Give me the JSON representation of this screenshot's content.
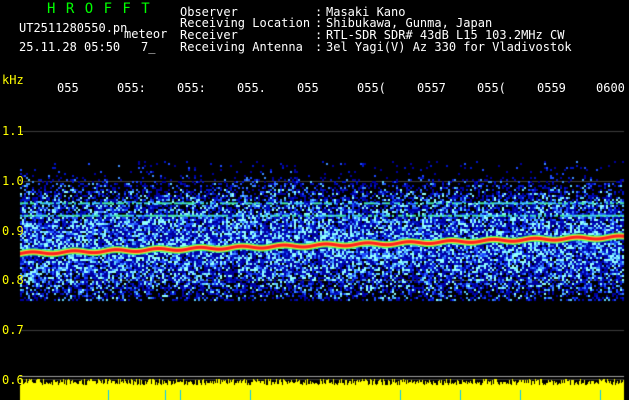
{
  "header": {
    "logo": "H R O F F T",
    "filename": "UT2511280550.pn",
    "suffix": "meteor",
    "datetime": "25.11.28 05:50",
    "count": "7_",
    "fields": [
      {
        "label": "Observer",
        "sep": ":",
        "value": "Masaki Kano"
      },
      {
        "label": "Receiving Location",
        "sep": ":",
        "value": "Shibukawa, Gunma, Japan"
      },
      {
        "label": "Receiver",
        "sep": ":",
        "value": "RTL-SDR SDR# 43dB L15 103.2MHz CW"
      },
      {
        "label": "Receiving Antenna",
        "sep": ":",
        "value": "3el Yagi(V) Az 330 for Vladivostok"
      }
    ]
  },
  "chart_data": {
    "type": "heatmap",
    "ylabel": "kHz",
    "yticks": [
      "1.1",
      "1.0",
      "0.9",
      "0.8",
      "0.7",
      "0.6"
    ],
    "ytick_values": [
      1.1,
      1.0,
      0.9,
      0.8,
      0.7,
      0.6
    ],
    "xticks": [
      "055",
      "055",
      "055",
      "055",
      "055",
      "055",
      "055",
      "055",
      "055",
      "0600"
    ],
    "xticks_shown_as": [
      "055",
      "055:",
      "055:",
      "055.",
      "055",
      "055(",
      "0557",
      "055(",
      "0559",
      "0600"
    ],
    "ylim": [
      0.58,
      1.15
    ],
    "noise_band_khz": [
      0.76,
      1.04
    ],
    "carrier": {
      "start_khz": 0.855,
      "end_khz": 0.888,
      "color": "#ff2020"
    },
    "faint_lines_khz": [
      0.955,
      0.93
    ],
    "colors": {
      "noise_dark": "#0000a0",
      "noise_mid": "#1e4bff",
      "noise_light": "#5fd2ff",
      "grid": "#3c3c3c",
      "level_bar": "#ffff00",
      "axis_text": "#ffff00",
      "tick_text": "#ffffff"
    }
  }
}
